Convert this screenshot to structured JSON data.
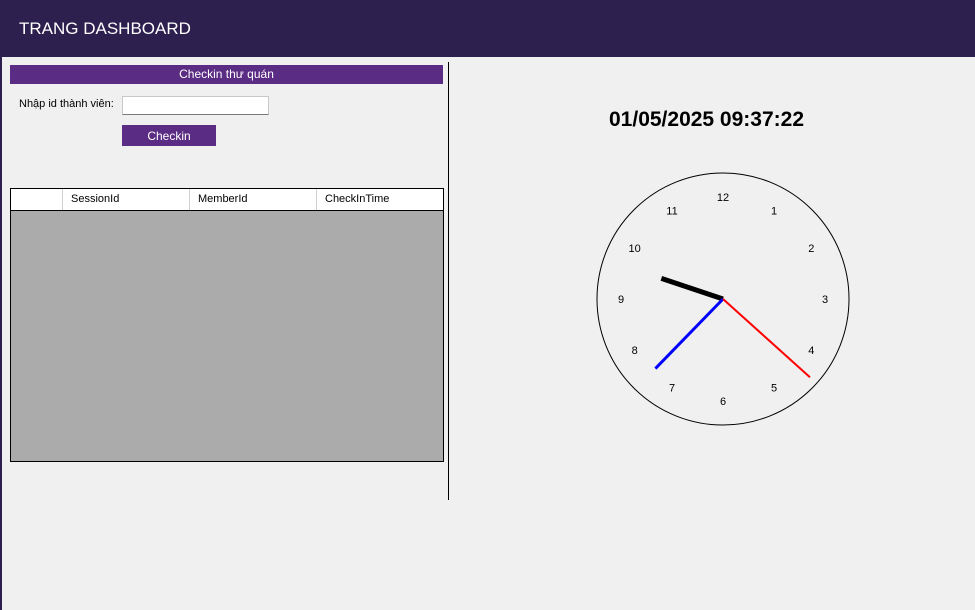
{
  "header": {
    "title": "TRANG DASHBOARD"
  },
  "checkin": {
    "section_title": "Checkin thư quán",
    "member_label": "Nhập id thành viên:",
    "member_value": "",
    "button_label": "Checkin"
  },
  "grid": {
    "columns": [
      "",
      "SessionId",
      "MemberId",
      "CheckInTime"
    ],
    "rows": []
  },
  "clock": {
    "datetime": "01/05/2025 09:37:22",
    "hour": 9,
    "minute": 37,
    "second": 22,
    "numbers": [
      "12",
      "1",
      "2",
      "3",
      "4",
      "5",
      "6",
      "7",
      "8",
      "9",
      "10",
      "11"
    ],
    "colors": {
      "hour": "#000000",
      "minute": "#0000ff",
      "second": "#ff0000"
    }
  },
  "colors": {
    "header_bg": "#2d1f4e",
    "accent": "#5b2c83",
    "grid_bg": "#ababab"
  }
}
